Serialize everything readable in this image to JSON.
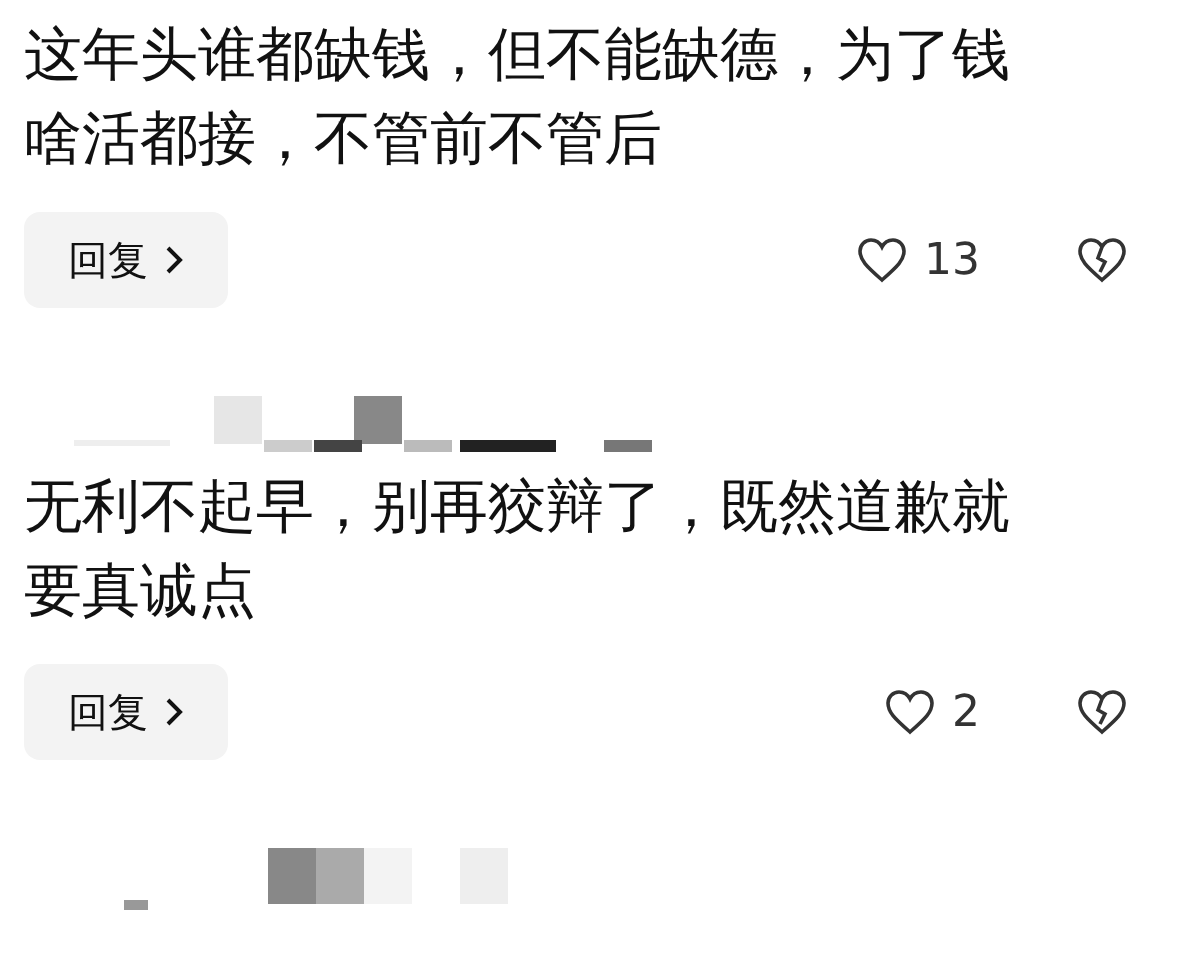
{
  "comments": [
    {
      "text": "这年头谁都缺钱，但不能缺德，为了钱啥活都接，不管前不管后",
      "reply": "回复",
      "likes": "13"
    },
    {
      "author_masked": true,
      "text": "无利不起早，别再狡辩了，既然道歉就要真诚点",
      "reply": "回复",
      "likes": "2"
    },
    {
      "author_masked": true
    }
  ]
}
